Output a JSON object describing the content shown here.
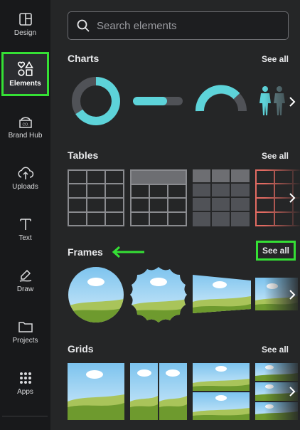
{
  "sidebar": {
    "items": [
      {
        "label": "Design",
        "icon": "layout-icon"
      },
      {
        "label": "Elements",
        "icon": "shapes-icon",
        "active": true
      },
      {
        "label": "Brand Hub",
        "icon": "brand-icon"
      },
      {
        "label": "Uploads",
        "icon": "cloud-upload-icon"
      },
      {
        "label": "Text",
        "icon": "text-icon"
      },
      {
        "label": "Draw",
        "icon": "draw-icon"
      },
      {
        "label": "Projects",
        "icon": "folder-icon"
      },
      {
        "label": "Apps",
        "icon": "apps-grid-icon"
      }
    ]
  },
  "search": {
    "placeholder": "Search elements"
  },
  "sections": {
    "charts": {
      "title": "Charts",
      "see_all": "See all"
    },
    "tables": {
      "title": "Tables",
      "see_all": "See all"
    },
    "frames": {
      "title": "Frames",
      "see_all": "See all"
    },
    "grids": {
      "title": "Grids",
      "see_all": "See all"
    }
  },
  "colors": {
    "highlight": "#35e035",
    "teal": "#5dd3d9",
    "panel_bg": "#252627",
    "sidebar_bg": "#18191b",
    "table_red": "#e26b62"
  }
}
